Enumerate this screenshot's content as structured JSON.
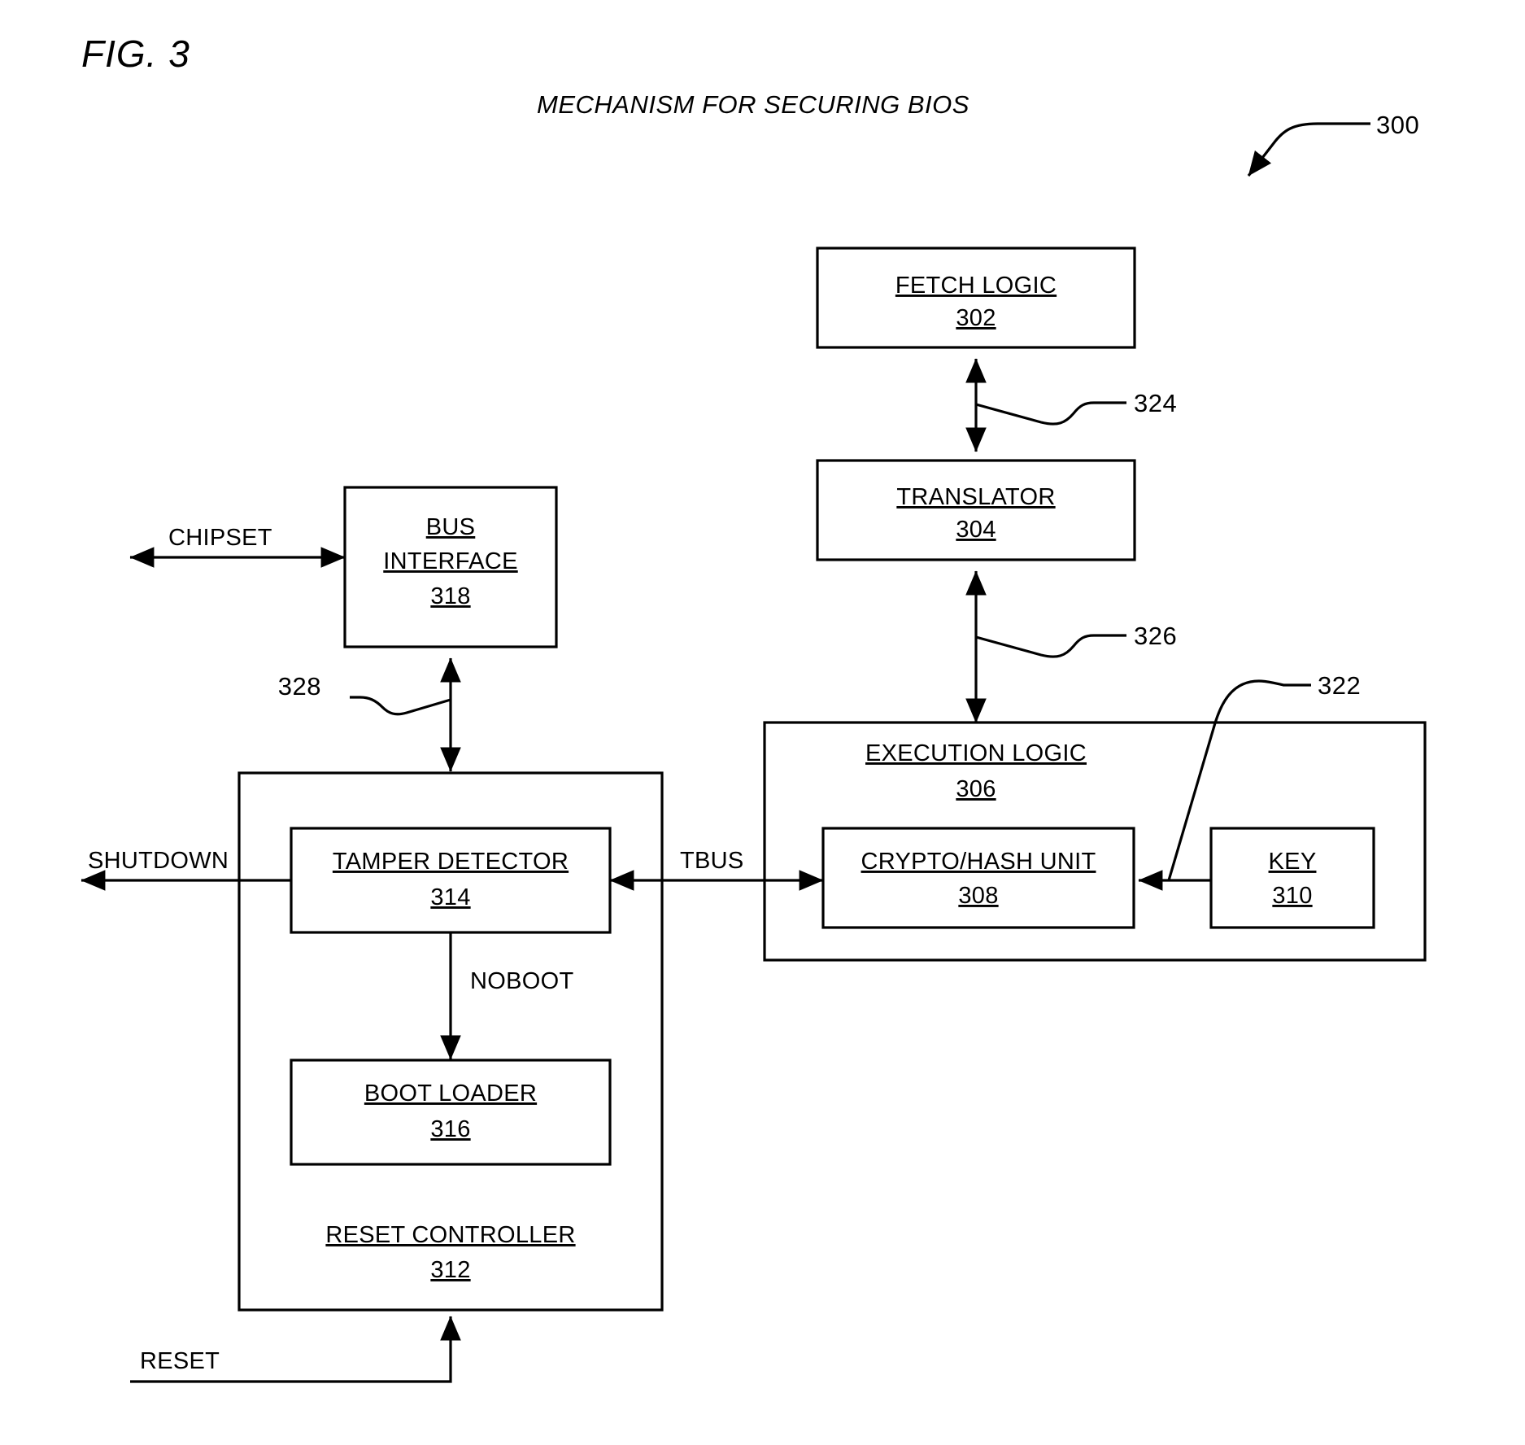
{
  "figure": {
    "label": "FIG. 3",
    "title": "MECHANISM FOR SECURING BIOS",
    "system_ref": "300"
  },
  "blocks": {
    "fetch_logic": {
      "name": "FETCH LOGIC",
      "ref": "302"
    },
    "translator": {
      "name": "TRANSLATOR",
      "ref": "304"
    },
    "execution_logic": {
      "name": "EXECUTION LOGIC",
      "ref": "306"
    },
    "crypto_hash_unit": {
      "name": "CRYPTO/HASH UNIT",
      "ref": "308"
    },
    "key": {
      "name": "KEY",
      "ref": "310"
    },
    "reset_controller": {
      "name": "RESET CONTROLLER",
      "ref": "312"
    },
    "tamper_detector": {
      "name": "TAMPER DETECTOR",
      "ref": "314"
    },
    "boot_loader": {
      "name": "BOOT LOADER",
      "ref": "316"
    },
    "bus_interface": {
      "name_line1": "BUS",
      "name_line2": "INTERFACE",
      "ref": "318"
    }
  },
  "signals": {
    "chipset": "CHIPSET",
    "shutdown": "SHUTDOWN",
    "tbus": "TBUS",
    "noboot": "NOBOOT",
    "reset": "RESET"
  },
  "connector_refs": {
    "bus_ref_322": "322",
    "fetch_translator_324": "324",
    "translator_exec_326": "326",
    "businterface_reset_328": "328"
  },
  "colors": {
    "stroke": "#000000",
    "fill": "#ffffff",
    "background": "#ffffff"
  }
}
